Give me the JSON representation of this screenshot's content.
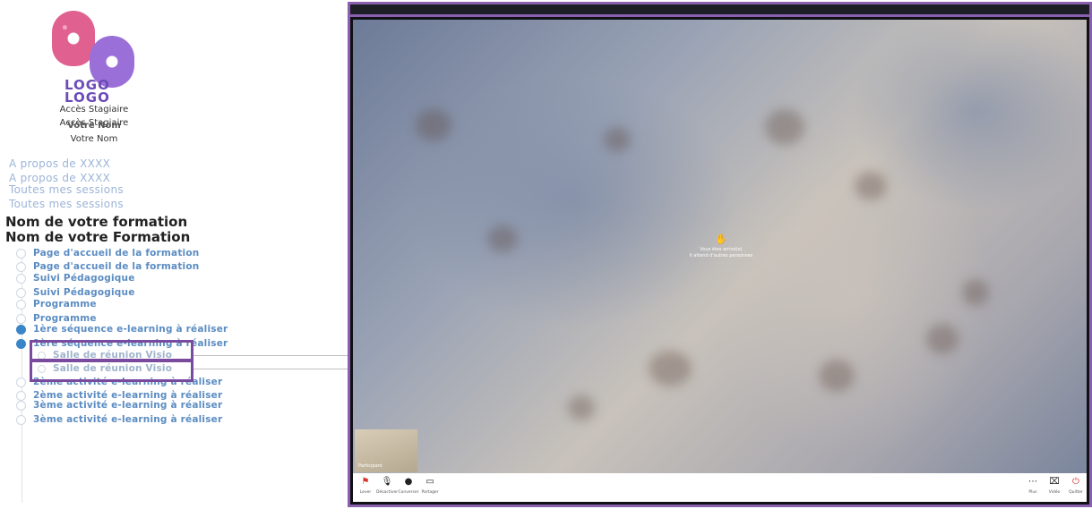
{
  "sidebar": {
    "logo_text_1": "LOGO",
    "logo_text_2": "LOGO",
    "access_label_1": "Accès Stagiaire",
    "access_label_2": "Accès Stagiaire",
    "user_name_1": "Votre Nom",
    "user_name_2": "Votre Nom",
    "links": [
      "A propos de XXXX",
      "A propos de XXXX",
      "Toutes mes sessions",
      "Toutes mes sessions"
    ],
    "course_title_1": "Nom de votre formation",
    "course_title_2": "Nom de votre Formation",
    "items": [
      "Page d'accueil de la formation",
      "Page d'accueil de la formation",
      "Suivi Pédagogique",
      "Suivi Pédagogique",
      "Programme",
      "Programme",
      "1ère séquence e-learning à réaliser",
      "1ère séquence e-learning à réaliser",
      "2ème activité e-learning à réaliser",
      "2ème activité e-learning à réaliser",
      "3ème activité e-learning à réaliser",
      "3ème activité e-learning à réaliser"
    ],
    "sub_items": [
      "Salle de réunion Visio",
      "Salle de réunion Visio"
    ]
  },
  "viewer": {
    "notice_line_1": "Vous êtes arrivé(e)",
    "notice_line_2": "Il attend d'autres personnes",
    "thumb_label": "Participant",
    "tools_left": [
      {
        "icon": "hand-icon",
        "label": "Lever"
      },
      {
        "icon": "mic-icon",
        "label": "Désactiver"
      },
      {
        "icon": "chat-icon",
        "label": "Converser"
      },
      {
        "icon": "screen-icon",
        "label": "Partager"
      }
    ],
    "tools_right": [
      {
        "icon": "more-icon",
        "label": "Plus"
      },
      {
        "icon": "camera-icon",
        "label": "Vidéo"
      },
      {
        "icon": "leave-icon",
        "label": "Quitter"
      }
    ],
    "accent_color": "#8a5fb0",
    "leave_color": "#d9342b"
  }
}
